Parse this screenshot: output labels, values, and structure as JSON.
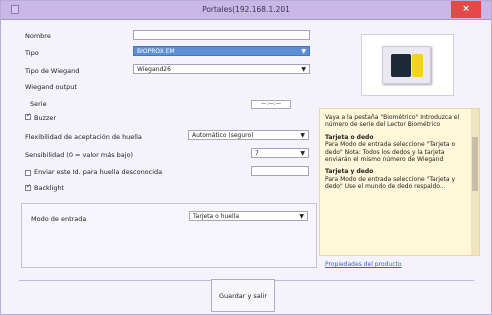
{
  "window": {
    "title": "Portales(192.168.1.201"
  },
  "form": {
    "nombre": {
      "label": "Nombre",
      "value": ""
    },
    "tipo": {
      "label": "Tipo",
      "value": "BIOPROX EM"
    },
    "tipo_wiegand": {
      "label": "Tipo de Wiegand",
      "value": "Wiegand26"
    },
    "wiegand_output_label": "Wiegand output",
    "serie": {
      "label": "Serie",
      "value": "—:—:—"
    },
    "buzzer": {
      "label": "Buzzer",
      "checked": true
    },
    "flexibilidad": {
      "label": "Flexibilidad de aceptación de huella",
      "value": "Automático (seguro)"
    },
    "sensibilidad": {
      "label": "Sensibilidad (0 = valor más bajo)",
      "value": "7"
    },
    "enviar": {
      "label": "Enviar este Id. para huella desconocida",
      "checked": false,
      "value": ""
    },
    "backlight": {
      "label": "Backlight",
      "checked": true
    },
    "modo": {
      "label": "Modo de entrada",
      "value": "Tarjeta o huella"
    }
  },
  "help": {
    "intro": "Vaya a la pestaña \"Biométrico\" Introduzca el número de serie del Lector Biométrico",
    "section1_title": "Tarjeta o dedo",
    "section1_text": "Para Modo de entrada seleccione \"Tarjeta o dedo\" Nota: Todos los dedos y la tarjeta enviarán el mismo número de Wiegand",
    "section2_title": "Tarjeta y dedo",
    "section2_text": "Para Modo de entrada seleccione \"Tarjeta y dedo\" Use el mundo de dedo respaldo..."
  },
  "link_text": "Propiedades del producto",
  "button_label": "Guardar y salir",
  "colors": {
    "title_bar": "#c9b8e6",
    "close": "#e54848",
    "selected": "#5c8fd6",
    "link": "#3569c5",
    "help_bg": "#fff7d9"
  },
  "icons": {
    "close": "close-icon",
    "dropdown": "chevron-down-icon",
    "device": "biometric-reader-image"
  }
}
